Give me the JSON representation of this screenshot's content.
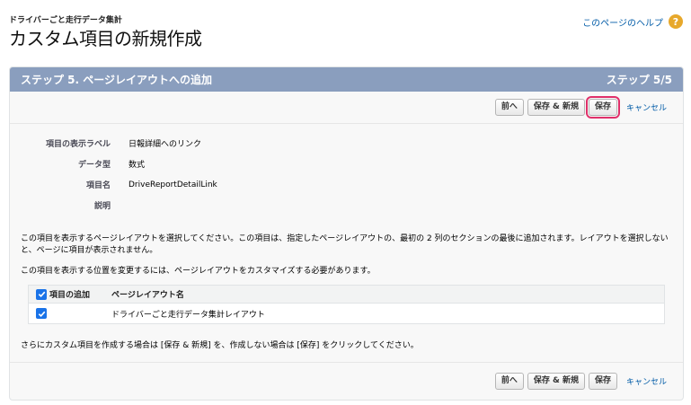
{
  "header": {
    "object_name": "ドライバーごと走行データ集計",
    "page_title": "カスタム項目の新規作成",
    "help_link": "このページのヘルプ",
    "help_icon": "question-mark"
  },
  "panel": {
    "step_title": "ステップ 5. ページレイアウトへの追加",
    "step_count": "ステップ 5/5"
  },
  "buttons": {
    "previous": "前へ",
    "save_new": "保存 & 新規",
    "save": "保存",
    "cancel": "キャンセル"
  },
  "fields": [
    {
      "label": "項目の表示ラベル",
      "value": "日報詳細へのリンク"
    },
    {
      "label": "データ型",
      "value": "数式"
    },
    {
      "label": "項目名",
      "value": "DriveReportDetailLink"
    },
    {
      "label": "説明",
      "value": ""
    }
  ],
  "instructions": {
    "select_layout": "この項目を表示するページレイアウトを選択してください。この項目は、指定したページレイアウトの、最初の 2 列のセクションの最後に追加されます。レイアウトを選択しないと、ページに項目が表示されません。",
    "customize_note": "この項目を表示する位置を変更するには、ページレイアウトをカスタマイズする必要があります。",
    "final_note": "さらにカスタム項目を作成する場合は [保存 & 新規] を、作成しない場合は [保存] をクリックしてください。"
  },
  "layout_table": {
    "col_add": "項目の追加",
    "col_layout": "ページレイアウト名",
    "rows": [
      {
        "layout_name": "ドライバーごと走行データ集計レイアウト",
        "checked": true
      }
    ]
  },
  "colors": {
    "panel_header": "#8a9ebe",
    "checkbox": "#1a73e8",
    "highlight": "#e0306a",
    "link": "#015ba7"
  }
}
